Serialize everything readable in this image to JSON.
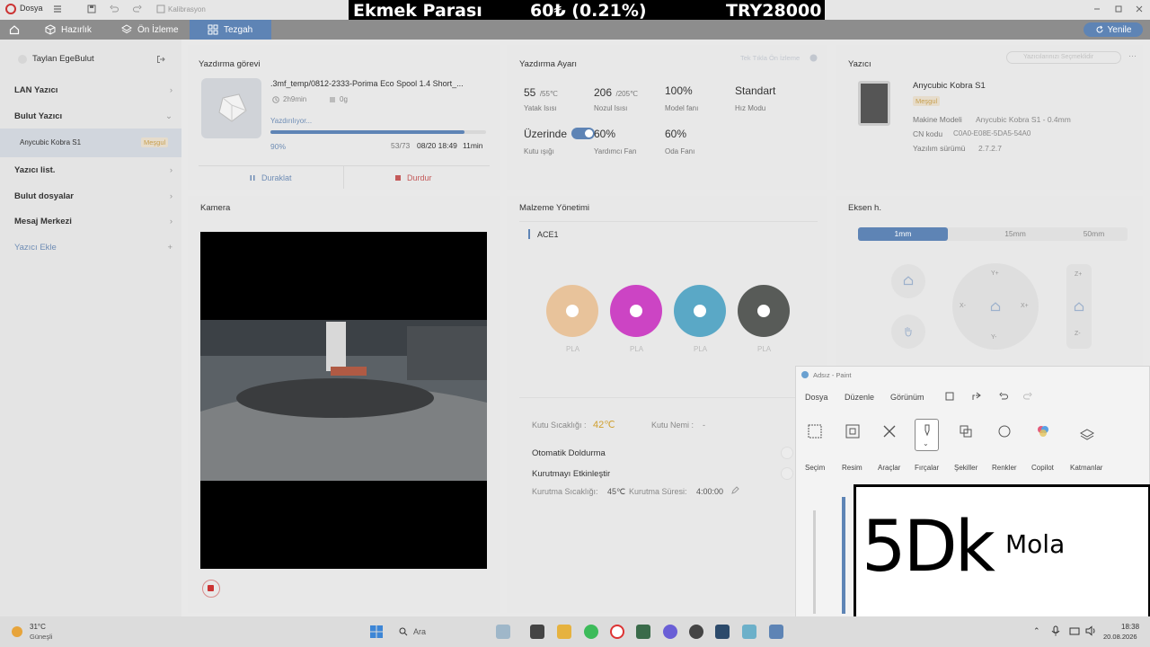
{
  "titlebar": {
    "file_label": "Dosya",
    "calibration_label": "Kalibrasyon"
  },
  "banner": {
    "label": "Ekmek Parası",
    "price": "60₺ (0.21%)",
    "total": "TRY28000"
  },
  "nav": {
    "tabs": [
      {
        "label": "Hazırlık"
      },
      {
        "label": "Ön İzleme"
      },
      {
        "label": "Tezgah"
      }
    ],
    "refresh_label": "Yenile"
  },
  "sidebar": {
    "username": "Taylan EgeBulut",
    "items": [
      {
        "label": "LAN Yazıcı"
      },
      {
        "label": "Bulut Yazıcı"
      },
      {
        "label": "Yazıcı list."
      },
      {
        "label": "Bulut dosyalar"
      },
      {
        "label": "Mesaj Merkezi"
      }
    ],
    "printer_name": "Anycubic Kobra S1",
    "printer_badge": "Meşgul",
    "add_printer_label": "Yazıcı Ekle"
  },
  "print_job": {
    "title": "Yazdırma görevi",
    "file": ".3mf_temp/0812-2333-Porima Eco Spool 1.4 Short_...",
    "duration": "2h9min",
    "weight": "0g",
    "status": "Yazdırılıyor...",
    "progress_pct": 90,
    "progress_label": "90%",
    "layers": "53/73",
    "eta": "08/20 18:49",
    "remaining": "11min",
    "pause_label": "Duraklat",
    "stop_label": "Durdur"
  },
  "print_settings": {
    "title": "Yazdırma Ayarı",
    "link_label": "Tek Tıkla Ön İzleme",
    "bed_temp": "55",
    "bed_target": "/55℃",
    "bed_label": "Yatak Isısı",
    "nozzle_temp": "206",
    "nozzle_target": "/205℃",
    "nozzle_label": "Nozul Isısı",
    "model_fan": "100%",
    "model_fan_label": "Model fanı",
    "speed_mode": "Standart",
    "speed_label": "Hız Modu",
    "light_state": "Üzerinde",
    "light_label": "Kutu ışığı",
    "aux_fan": "60%",
    "aux_fan_label": "Yardımcı Fan",
    "room_fan": "60%",
    "room_fan_label": "Oda Fanı"
  },
  "printer": {
    "title": "Yazıcı",
    "selector_label": "Yazıcılarınızı Seçmeklidir",
    "name": "Anycubic Kobra S1",
    "status": "Meşgul",
    "model_label": "Makine Modeli",
    "model_value": "Anycubic Kobra S1 - 0.4mm",
    "cn_label": "CN kodu",
    "cn_value": "C0A0-E08E-5DA5-54A0",
    "fw_label": "Yazılım sürümü",
    "fw_value": "2.7.2.7"
  },
  "camera": {
    "title": "Kamera"
  },
  "material": {
    "title": "Malzeme Yönetimi",
    "unit": "ACE1",
    "spools": [
      {
        "type": "PLA",
        "color": "#e8c39b"
      },
      {
        "type": "PLA",
        "color": "#cc44c4"
      },
      {
        "type": "PLA",
        "color": "#5aa8c6"
      },
      {
        "type": "PLA",
        "color": "#585b58"
      }
    ],
    "box_temp_label": "Kutu Sıcaklığı :",
    "box_temp": "42℃",
    "box_humidity_label": "Kutu Nemi :",
    "box_humidity": "-",
    "auto_refill": "Otomatik Doldurma",
    "enable_drying": "Kurutmayı Etkinleştir",
    "dry_temp_label": "Kurutma Sıcaklığı:",
    "dry_temp": "45℃",
    "dry_time_label": "Kurutma Süresi:",
    "dry_time": "4:00:00"
  },
  "axis": {
    "title": "Eksen h.",
    "steps": [
      "1mm",
      "15mm",
      "50mm"
    ],
    "labels": {
      "y_plus": "Y+",
      "y_minus": "Y-",
      "x_minus": "X-",
      "x_plus": "X+",
      "z_plus": "Z+",
      "z_minus": "Z-"
    }
  },
  "paint": {
    "window_title": "Adsız - Paint",
    "menu": [
      "Dosya",
      "Düzenle",
      "Görünüm"
    ],
    "tools": [
      "Seçim",
      "Resim",
      "Araçlar",
      "Fırçalar",
      "Şekiller",
      "Renkler",
      "Copilot",
      "Katmanlar"
    ],
    "canvas_text_1": "5Dk",
    "canvas_text_2": "Mola"
  },
  "taskbar": {
    "weather_temp": "31°C",
    "weather_desc": "Güneşli",
    "search_placeholder": "Ara",
    "time": "18:38",
    "date": "20.08.2026"
  },
  "colors": {
    "accent": "#5e84b5",
    "progress": "#5e84b5",
    "temp_accent": "#d0a030"
  }
}
